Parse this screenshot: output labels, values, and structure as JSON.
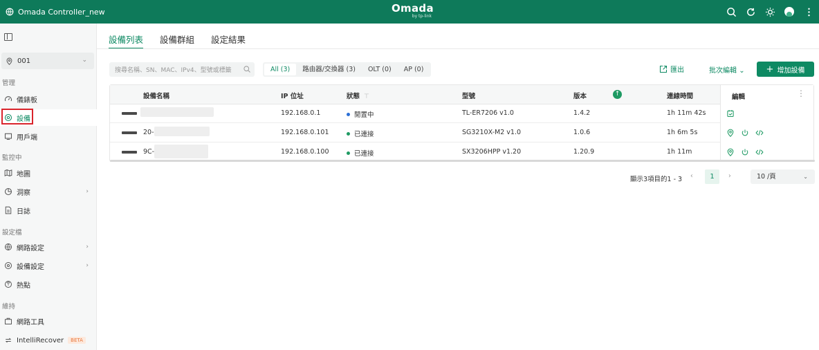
{
  "topbar": {
    "site_name": "Omada Controller_new",
    "brand": "Omada",
    "brand_sub": "by tp-link"
  },
  "sidebar": {
    "site_selector": "001",
    "sections": {
      "manage": "管理",
      "monitor": "監控中",
      "config": "設定檔",
      "maintain": "維持"
    },
    "items": {
      "dashboard": "儀錶板",
      "devices": "設備",
      "clients": "用戶端",
      "map": "地圖",
      "insight": "洞察",
      "logs": "日誌",
      "network_config": "網路設定",
      "device_config": "設備設定",
      "hotspot": "熱點",
      "network_tools": "網路工具",
      "intellirecover": "IntelliRecover",
      "beta": "BETA"
    }
  },
  "tabs": [
    "設備列表",
    "設備群組",
    "設定結果"
  ],
  "toolbar": {
    "search_placeholder": "搜尋名稱、SN、MAC、IPv4、型號或標籤",
    "filters": [
      "All (3)",
      "路由器/交換器 (3)",
      "OLT (0)",
      "AP (0)"
    ],
    "export_label": "匯出",
    "batch_label": "批次編輯",
    "add_label": "增加設備"
  },
  "table": {
    "headers": {
      "name": "設備名稱",
      "ip": "IP 位址",
      "status": "狀態",
      "model": "型號",
      "version": "版本",
      "uptime": "連線時間",
      "actions": "編輯"
    },
    "rows": [
      {
        "name": "",
        "ip": "192.168.0.1",
        "status": "閒置中",
        "status_color": "#2b6fd6",
        "model": "TL-ER7206 v1.0",
        "version": "1.4.2",
        "uptime": "1h 11m 42s"
      },
      {
        "name": "20-",
        "ip": "192.168.0.101",
        "status": "已連接",
        "status_color": "#1e9a63",
        "model": "SG3210X-M2 v1.0",
        "version": "1.0.6",
        "uptime": "1h 6m 5s"
      },
      {
        "name": "9C-",
        "ip": "192.168.0.100",
        "status": "已連接",
        "status_color": "#1e9a63",
        "model": "SX3206HPP v1.20",
        "version": "1.20.9",
        "uptime": "1h 11m"
      }
    ]
  },
  "pagination": {
    "summary": "顯示3項目的1 - 3",
    "current_page": "1",
    "page_size": "10 /頁"
  },
  "colors": {
    "brand": "#0e7a5a",
    "accent": "#0e8a63",
    "highlight": "#d9232b"
  }
}
